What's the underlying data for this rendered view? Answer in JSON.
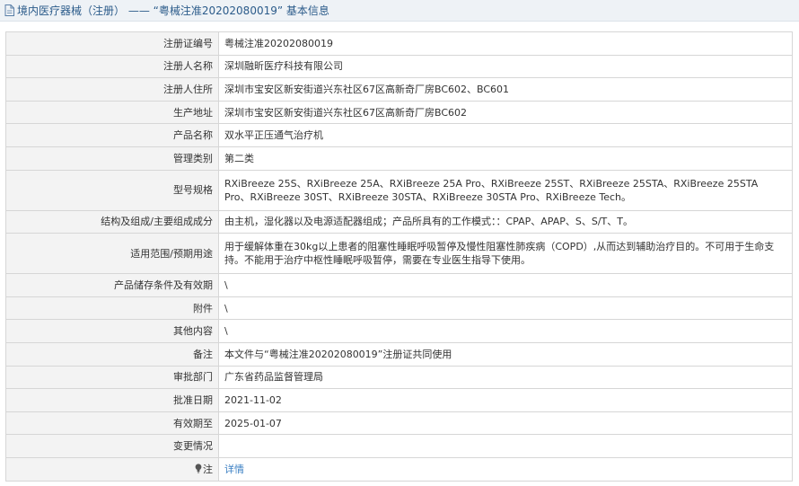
{
  "header": {
    "prefix": "境内医疗器械（注册）",
    "separator": " —— ",
    "quoted_id": "“粤械注准20202080019”",
    "suffix": " 基本信息"
  },
  "rows": [
    {
      "label": "注册证编号",
      "value": "粤械注准20202080019"
    },
    {
      "label": "注册人名称",
      "value": "深圳融昕医疗科技有限公司"
    },
    {
      "label": "注册人住所",
      "value": "深圳市宝安区新安街道兴东社区67区高新奇厂房BC602、BC601"
    },
    {
      "label": "生产地址",
      "value": "深圳市宝安区新安街道兴东社区67区高新奇厂房BC602"
    },
    {
      "label": "产品名称",
      "value": "双水平正压通气治疗机"
    },
    {
      "label": "管理类别",
      "value": "第二类"
    },
    {
      "label": "型号规格",
      "value": "RXiBreeze 25S、RXiBreeze 25A、RXiBreeze 25A Pro、RXiBreeze 25ST、RXiBreeze 25STA、RXiBreeze 25STA Pro、RXiBreeze 30ST、RXiBreeze 30STA、RXiBreeze 30STA Pro、RXiBreeze Tech。"
    },
    {
      "label": "结构及组成/主要组成成分",
      "value": "由主机，湿化器以及电源适配器组成；产品所具有的工作模式：：CPAP、APAP、S、S/T、T。"
    },
    {
      "label": "适用范围/预期用途",
      "value": "用于缓解体重在30kg以上患者的阻塞性睡眠呼吸暂停及慢性阻塞性肺疾病（COPD）,从而达到辅助治疗目的。不可用于生命支持。不能用于治疗中枢性睡眠呼吸暂停，需要在专业医生指导下使用。"
    },
    {
      "label": "产品储存条件及有效期",
      "value": "\\"
    },
    {
      "label": "附件",
      "value": "\\"
    },
    {
      "label": "其他内容",
      "value": "\\"
    },
    {
      "label": "备注",
      "value": "本文件与“粤械注准20202080019”注册证共同使用"
    },
    {
      "label": "审批部门",
      "value": "广东省药品监督管理局"
    },
    {
      "label": "批准日期",
      "value": "2021-11-02"
    },
    {
      "label": "有效期至",
      "value": "2025-01-07"
    },
    {
      "label": "变更情况",
      "value": ""
    }
  ],
  "note_row": {
    "label": "注",
    "icon": "lightbulb-icon",
    "link_text": "详情"
  },
  "colors": {
    "header_text": "#2b5b8a",
    "link": "#3a7fc3",
    "label_bg": "#f3f3f3",
    "border": "#d6d6d6"
  }
}
